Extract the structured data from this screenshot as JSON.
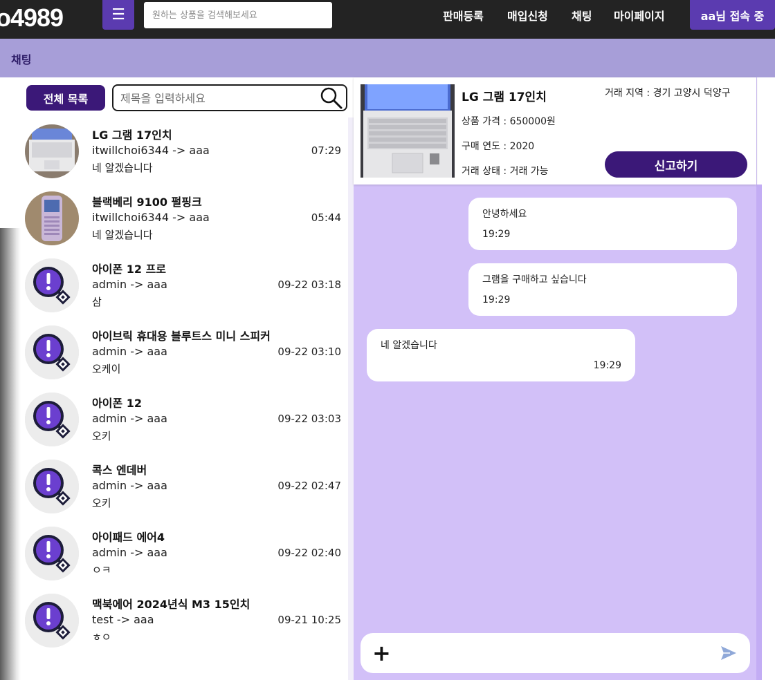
{
  "header": {
    "logo": "o4989",
    "menu_icon": "hamburger-icon",
    "search_placeholder": "원하는 상품을 검색해보세요",
    "nav": [
      "판매등록",
      "매입신청",
      "채팅",
      "마이페이지"
    ],
    "user_status": "aa님 접속 중"
  },
  "page": {
    "title": "채팅"
  },
  "list": {
    "all_button": "전체 목록",
    "search_placeholder": "제목을 입력하세요",
    "items": [
      {
        "title": "LG 그램 17인치",
        "users": "itwillchoi6344 -> aaa",
        "time": "07:29",
        "message": "네 알겠습니다",
        "thumb": "laptop"
      },
      {
        "title": "블랙베리 9100 펄핑크",
        "users": "itwillchoi6344 -> aaa",
        "time": "05:44",
        "message": "네 알겠습니다",
        "thumb": "phone"
      },
      {
        "title": "아이폰 12 프로",
        "users": "admin -> aaa",
        "time": "09-22 03:18",
        "message": "삼",
        "thumb": "alert"
      },
      {
        "title": "아이브릭 휴대용 블루트스 미니 스피커",
        "users": "admin -> aaa",
        "time": "09-22 03:10",
        "message": "오케이",
        "thumb": "alert"
      },
      {
        "title": "아이폰 12",
        "users": "admin -> aaa",
        "time": "09-22 03:03",
        "message": "오키",
        "thumb": "alert"
      },
      {
        "title": "콕스 엔데버",
        "users": "admin -> aaa",
        "time": "09-22 02:47",
        "message": "오키",
        "thumb": "alert"
      },
      {
        "title": "아이패드 에어4",
        "users": "admin -> aaa",
        "time": "09-22 02:40",
        "message": "ㅇㅋ",
        "thumb": "alert"
      },
      {
        "title": "맥북에어 2024년식 M3 15인치",
        "users": "test -> aaa",
        "time": "09-21 10:25",
        "message": "ㅎㅇ",
        "thumb": "alert"
      }
    ]
  },
  "product": {
    "name": "LG 그램 17인치",
    "price": "상품 가격 : 650000원",
    "year": "구매 연도 : 2020",
    "status": "거래 상태 : 거래 가능",
    "region": "거래 지역 : 경기 고양시 덕양구",
    "report_button": "신고하기"
  },
  "messages": [
    {
      "text": "안녕하세요",
      "time": "19:29",
      "side": "right"
    },
    {
      "text": "그램을 구매하고 싶습니다",
      "time": "19:29",
      "side": "right"
    },
    {
      "text": "네 알겠습니다",
      "time": "19:29",
      "side": "left"
    }
  ],
  "input": {
    "plus_icon": "plus-icon",
    "send_icon": "send-icon"
  },
  "colors": {
    "topbar": "#232323",
    "accent": "#5b3bb0",
    "dark_purple": "#3b1878",
    "subheader": "#a79ed8",
    "chat_bg": "#d2c0f8"
  }
}
